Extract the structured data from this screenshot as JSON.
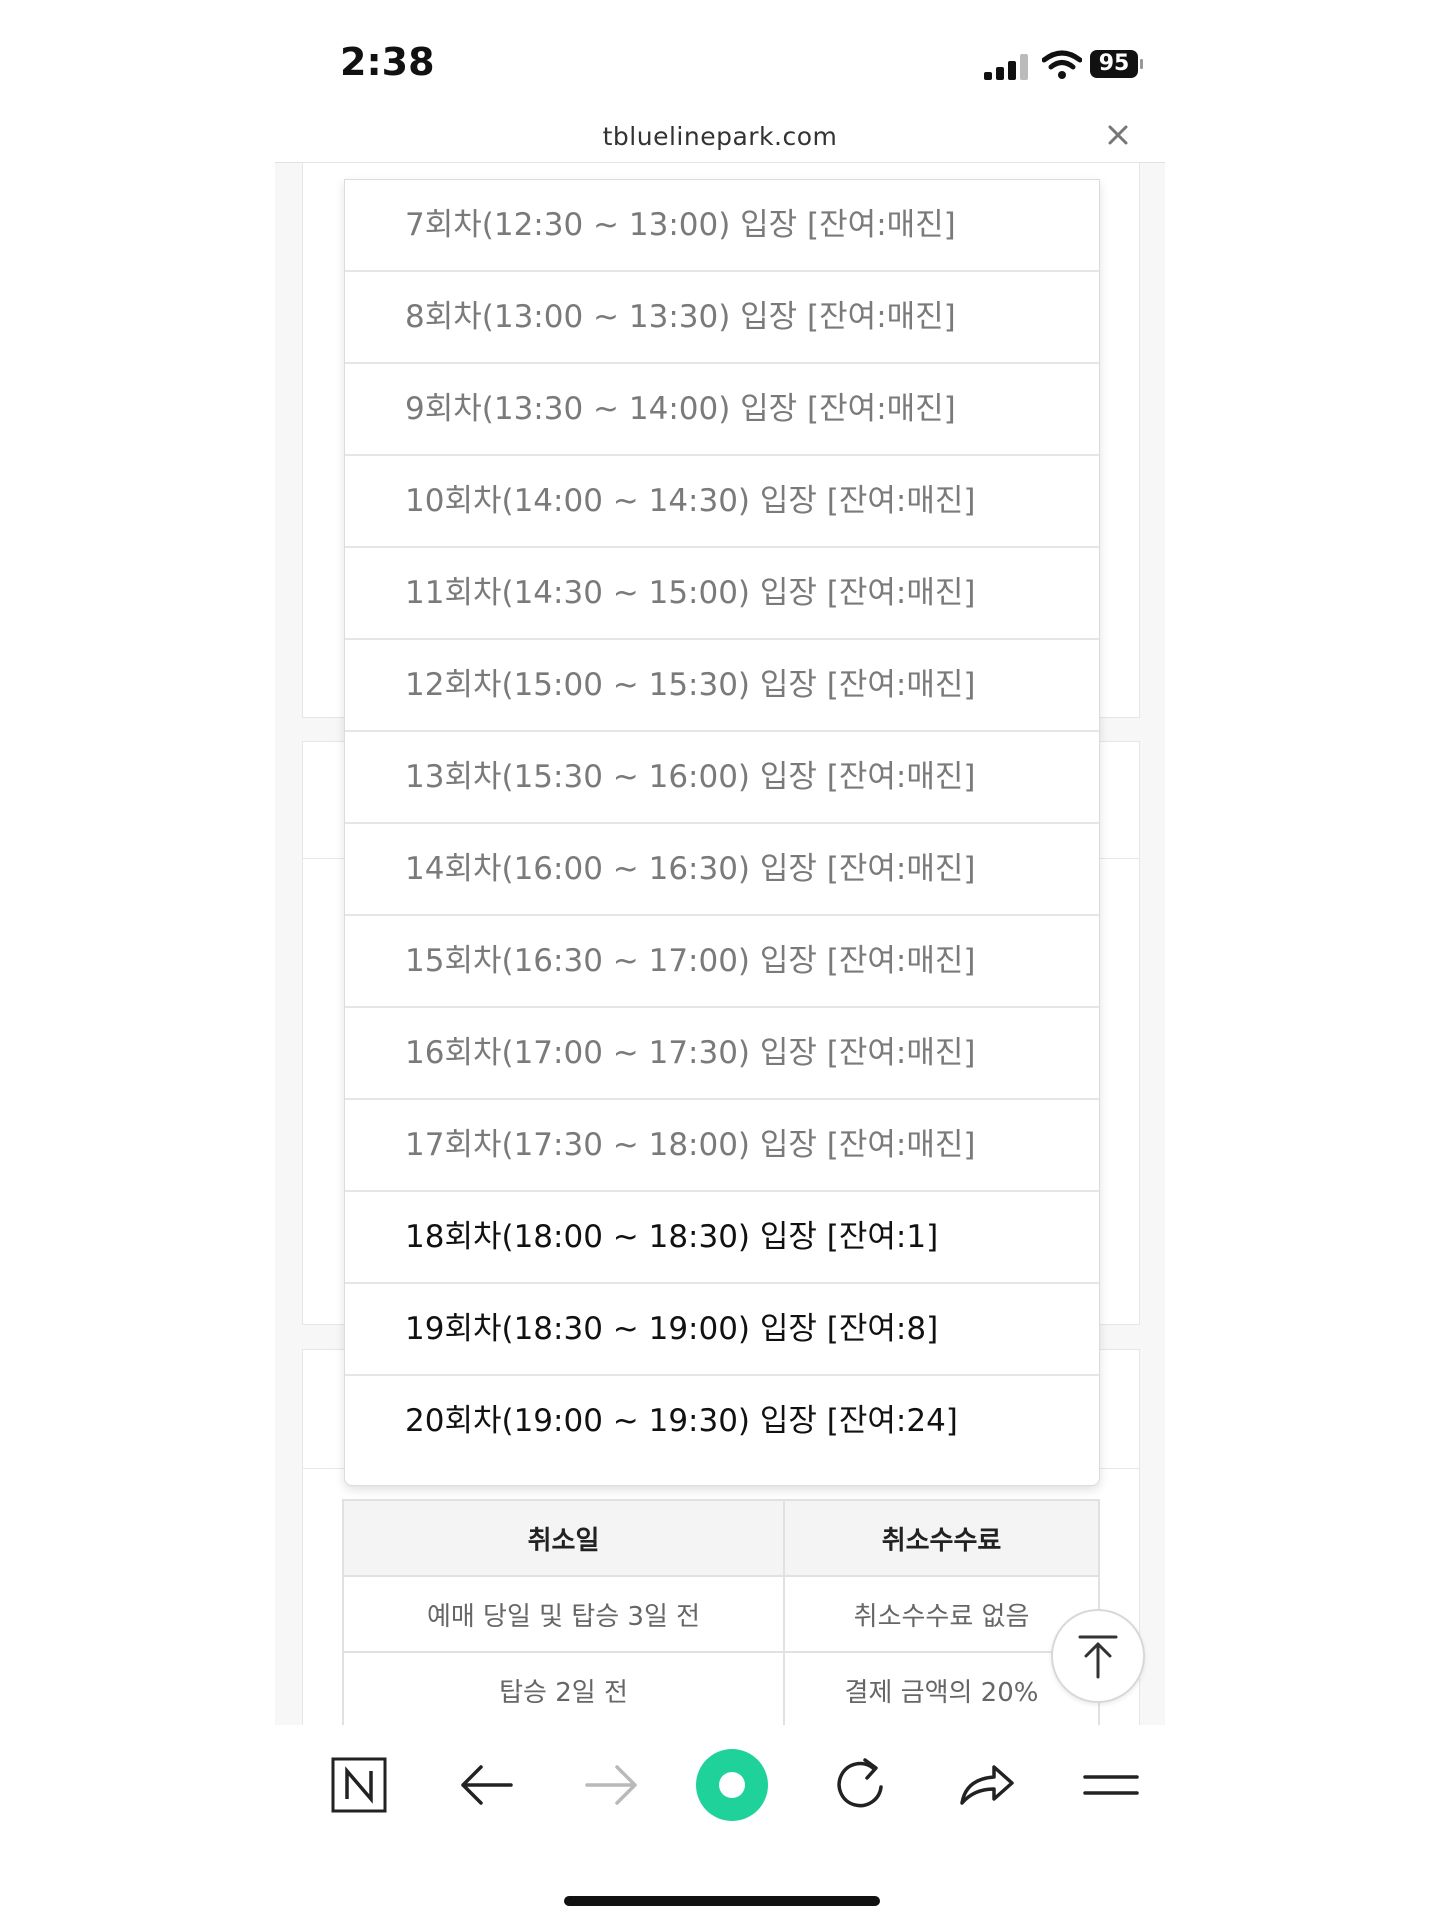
{
  "status_bar": {
    "time": "2:38",
    "battery": "95"
  },
  "browser": {
    "url": "tbluelinepark.com"
  },
  "dropdown": {
    "options": [
      {
        "label": "7회차(12:30 ~ 13:00) 입장 [잔여:매진]",
        "available": false
      },
      {
        "label": "8회차(13:00 ~ 13:30) 입장 [잔여:매진]",
        "available": false
      },
      {
        "label": "9회차(13:30 ~ 14:00) 입장 [잔여:매진]",
        "available": false
      },
      {
        "label": "10회차(14:00 ~ 14:30) 입장 [잔여:매진]",
        "available": false
      },
      {
        "label": "11회차(14:30 ~ 15:00) 입장 [잔여:매진]",
        "available": false
      },
      {
        "label": "12회차(15:00 ~ 15:30) 입장 [잔여:매진]",
        "available": false
      },
      {
        "label": "13회차(15:30 ~ 16:00) 입장 [잔여:매진]",
        "available": false
      },
      {
        "label": "14회차(16:00 ~ 16:30) 입장 [잔여:매진]",
        "available": false
      },
      {
        "label": "15회차(16:30 ~ 17:00) 입장 [잔여:매진]",
        "available": false
      },
      {
        "label": "16회차(17:00 ~ 17:30) 입장 [잔여:매진]",
        "available": false
      },
      {
        "label": "17회차(17:30 ~ 18:00) 입장 [잔여:매진]",
        "available": false
      },
      {
        "label": "18회차(18:00 ~ 18:30) 입장 [잔여:1]",
        "available": true
      },
      {
        "label": "19회차(18:30 ~ 19:00) 입장 [잔여:8]",
        "available": true
      },
      {
        "label": "20회차(19:00 ~ 19:30) 입장 [잔여:24]",
        "available": true
      }
    ]
  },
  "cancel_table": {
    "headers": [
      "취소일",
      "취소수수료"
    ],
    "rows": [
      [
        "예매 당일 및 탑승 3일 전",
        "취소수수료 없음"
      ],
      [
        "탑승 2일 전",
        "결제 금액의 20%"
      ]
    ]
  },
  "toolbar": {
    "items": [
      "naver-home",
      "back",
      "forward",
      "green-dot",
      "reload",
      "share",
      "menu"
    ]
  },
  "colors": {
    "accent_green": "#1ed29a",
    "disabled_text": "#7a7a7a",
    "enabled_text": "#111111"
  }
}
